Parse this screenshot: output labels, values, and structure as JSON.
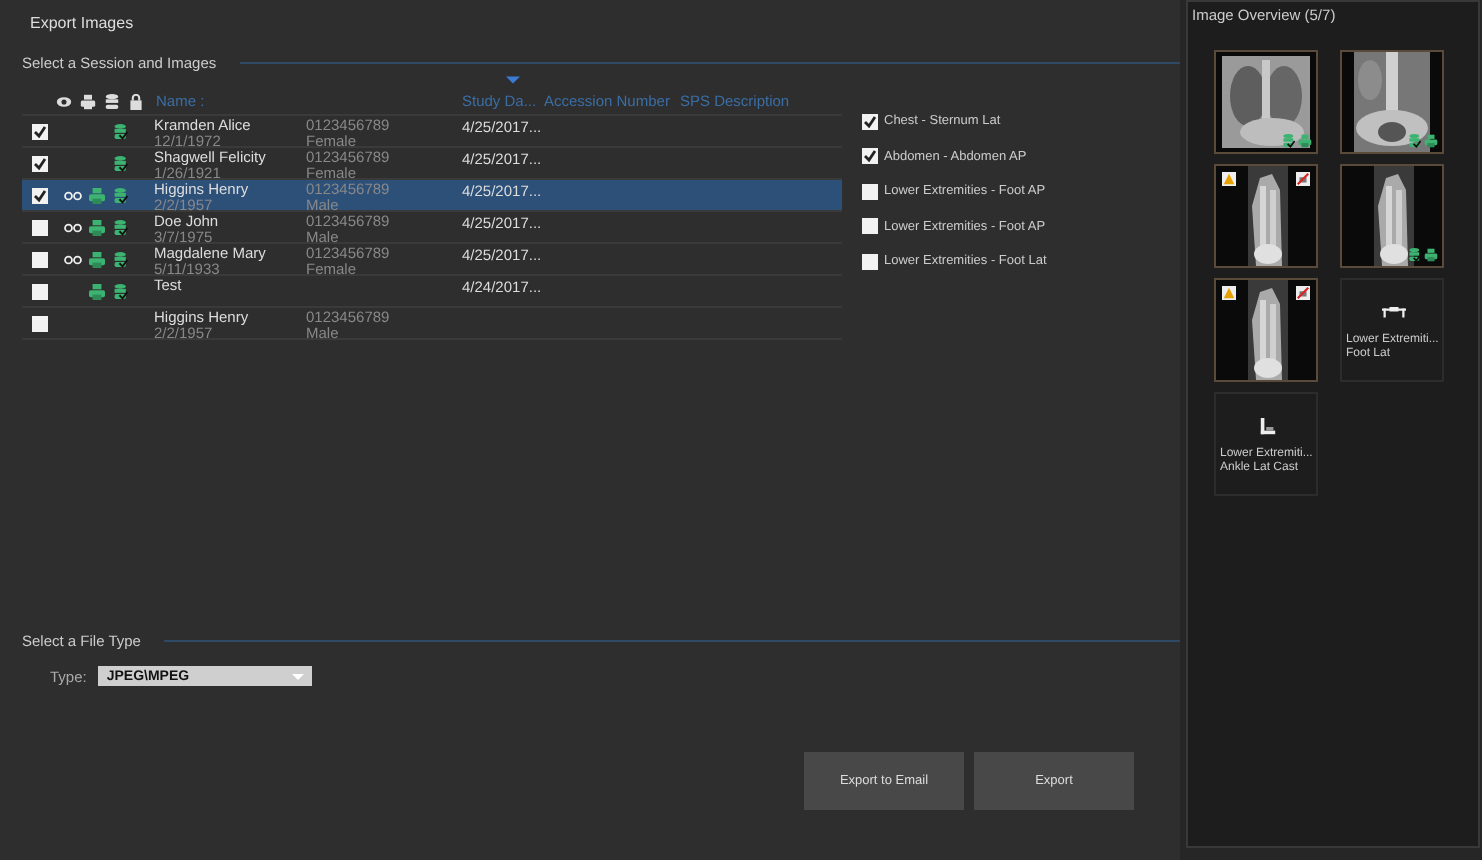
{
  "title": "Export Images",
  "session_section": {
    "title": "Select a Session and Images"
  },
  "columns": [
    {
      "label": "Name :",
      "sorted": false
    },
    {
      "label": "Study Da...",
      "sorted": true
    },
    {
      "label": "Accession Number",
      "sorted": false
    },
    {
      "label": "SPS Description",
      "sorted": false
    }
  ],
  "rows": [
    {
      "checked": true,
      "selected": false,
      "linked": false,
      "printed": false,
      "stored": true,
      "name": "Kramden Alice",
      "birth_date": "12/1/1972",
      "patient_id": "0123456789",
      "sex": "Female",
      "study_date": "4/25/2017..."
    },
    {
      "checked": true,
      "selected": false,
      "linked": false,
      "printed": false,
      "stored": true,
      "name": "Shagwell Felicity",
      "birth_date": "1/26/1921",
      "patient_id": "0123456789",
      "sex": "Female",
      "study_date": "4/25/2017..."
    },
    {
      "checked": true,
      "selected": true,
      "linked": true,
      "printed": true,
      "stored": true,
      "name": "Higgins Henry",
      "birth_date": "2/2/1957",
      "patient_id": "0123456789",
      "sex": "Male",
      "study_date": "4/25/2017..."
    },
    {
      "checked": false,
      "selected": false,
      "linked": true,
      "printed": true,
      "stored": true,
      "name": "Doe John",
      "birth_date": "3/7/1975",
      "patient_id": "0123456789",
      "sex": "Male",
      "study_date": "4/25/2017..."
    },
    {
      "checked": false,
      "selected": false,
      "linked": true,
      "printed": true,
      "stored": true,
      "name": "Magdalene Mary",
      "birth_date": "5/11/1933",
      "patient_id": "0123456789",
      "sex": "Female",
      "study_date": "4/25/2017..."
    },
    {
      "checked": false,
      "selected": false,
      "linked": false,
      "printed": true,
      "stored": true,
      "name": "Test",
      "birth_date": "",
      "patient_id": "",
      "sex": "",
      "study_date": "4/24/2017..."
    },
    {
      "checked": false,
      "selected": false,
      "linked": false,
      "printed": false,
      "stored": false,
      "name": "Higgins Henry",
      "birth_date": "2/2/1957",
      "patient_id": "0123456789",
      "sex": "Male",
      "study_date": ""
    }
  ],
  "series": [
    {
      "label": "Chest - Sternum Lat",
      "checked": true
    },
    {
      "label": "Abdomen - Abdomen AP",
      "checked": true
    },
    {
      "label": "Lower Extremities - Foot AP",
      "checked": false
    },
    {
      "label": "Lower Extremities - Foot AP",
      "checked": false
    },
    {
      "label": "Lower Extremities - Foot Lat",
      "checked": false
    }
  ],
  "file_type": {
    "title": "Select a File Type",
    "label": "Type:",
    "value": "JPEG\\MPEG"
  },
  "buttons": [
    "Export to Email",
    "Export"
  ],
  "overview": {
    "title": "Image Overview (5/7)",
    "thumbnails": [
      {
        "kind": "picture",
        "warning": false,
        "blocked": false,
        "stored": true,
        "printed": true
      },
      {
        "kind": "picture",
        "warning": false,
        "blocked": false,
        "stored": true,
        "printed": true
      },
      {
        "kind": "picture",
        "warning": true,
        "blocked": true,
        "stored": false,
        "printed": false
      },
      {
        "kind": "picture",
        "warning": false,
        "blocked": false,
        "stored": true,
        "printed": true
      },
      {
        "kind": "picture",
        "warning": true,
        "blocked": true,
        "stored": false,
        "printed": false
      },
      {
        "kind": "lying",
        "label": "Lower Extremiti...",
        "sublabel": "Foot Lat"
      },
      {
        "kind": "sitting",
        "label": "Lower Extremiti...",
        "sublabel": "Ankle Lat Cast"
      }
    ]
  }
}
